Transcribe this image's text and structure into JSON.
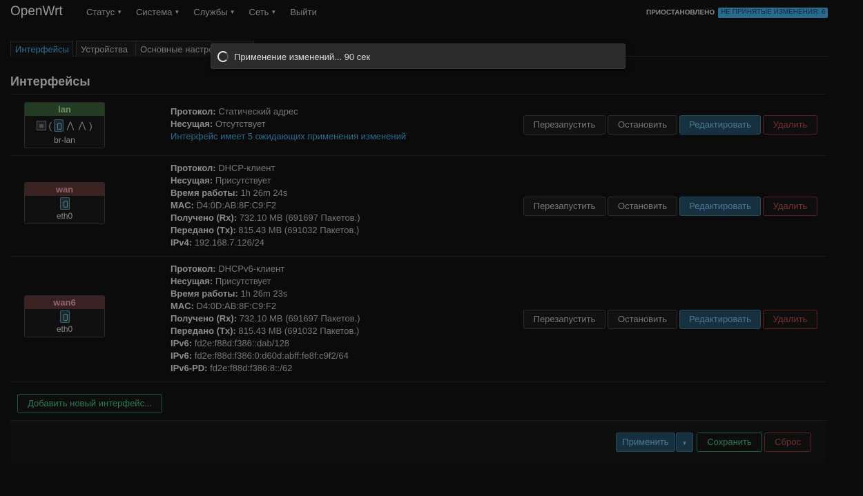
{
  "app": {
    "brand": "OpenWrt",
    "nav": [
      {
        "label": "Статус",
        "dropdown": true
      },
      {
        "label": "Система",
        "dropdown": true
      },
      {
        "label": "Службы",
        "dropdown": true
      },
      {
        "label": "Сеть",
        "dropdown": true
      },
      {
        "label": "Выйти",
        "dropdown": false
      }
    ],
    "status_indicator": "ПРИОСТАНОВЛЕНО",
    "changes_badge": "НЕ ПРИНЯТЫЕ ИЗМЕНЕНИЯ: 6"
  },
  "tabs": [
    "Интерфейсы",
    "Устройства",
    "Основные настройки"
  ],
  "section_title": "Интерфейсы",
  "interfaces": [
    {
      "name": "lan",
      "device": "br-lan",
      "lines": [
        {
          "label": "Протокол:",
          "value": "Статический адрес"
        },
        {
          "label": "Несущая:",
          "value": "Отсутствует"
        }
      ],
      "pending": "Интерфейс имеет 5 ожидающих применения изменений"
    },
    {
      "name": "wan",
      "device": "eth0",
      "lines": [
        {
          "label": "Протокол:",
          "value": "DHCP-клиент"
        },
        {
          "label": "Несущая:",
          "value": "Присутствует"
        },
        {
          "label": "Время работы:",
          "value": "1h 26m 24s"
        },
        {
          "label": "MAC:",
          "value": "D4:0D:AB:8F:C9:F2"
        },
        {
          "label": "Получено (Rx):",
          "value": "732.10 MB (691697 Пакетов.)"
        },
        {
          "label": "Передано (Tx):",
          "value": "815.43 MB (691032 Пакетов.)"
        },
        {
          "label": "IPv4:",
          "value": "192.168.7.126/24"
        }
      ]
    },
    {
      "name": "wan6",
      "device": "eth0",
      "lines": [
        {
          "label": "Протокол:",
          "value": "DHCPv6-клиент"
        },
        {
          "label": "Несущая:",
          "value": "Присутствует"
        },
        {
          "label": "Время работы:",
          "value": "1h 26m 23s"
        },
        {
          "label": "MAC:",
          "value": "D4:0D:AB:8F:C9:F2"
        },
        {
          "label": "Получено (Rx):",
          "value": "732.10 MB (691697 Пакетов.)"
        },
        {
          "label": "Передано (Tx):",
          "value": "815.43 MB (691032 Пакетов.)"
        },
        {
          "label": "IPv6:",
          "value": "fd2e:f88d:f386::dab/128"
        },
        {
          "label": "IPv6:",
          "value": "fd2e:f88d:f386:0:d60d:abff:fe8f:c9f2/64"
        },
        {
          "label": "IPv6-PD:",
          "value": "fd2e:f88d:f386:8::/62"
        }
      ]
    }
  ],
  "row_buttons": {
    "restart": "Перезапустить",
    "stop": "Остановить",
    "edit": "Редактировать",
    "delete": "Удалить"
  },
  "add_interface": "Добавить новый интерфейс...",
  "footer": {
    "apply": "Применить",
    "save": "Сохранить",
    "reset": "Сброс"
  },
  "modal": {
    "text": "Применение изменений... 90 сек"
  },
  "colors": {
    "background": "#0b0b0b",
    "accent_blue": "#2a6a8c",
    "lan_head": "#243b24",
    "wan_head": "#3a2222",
    "delete_red": "#7a3030",
    "save_green": "#2e7a52"
  }
}
